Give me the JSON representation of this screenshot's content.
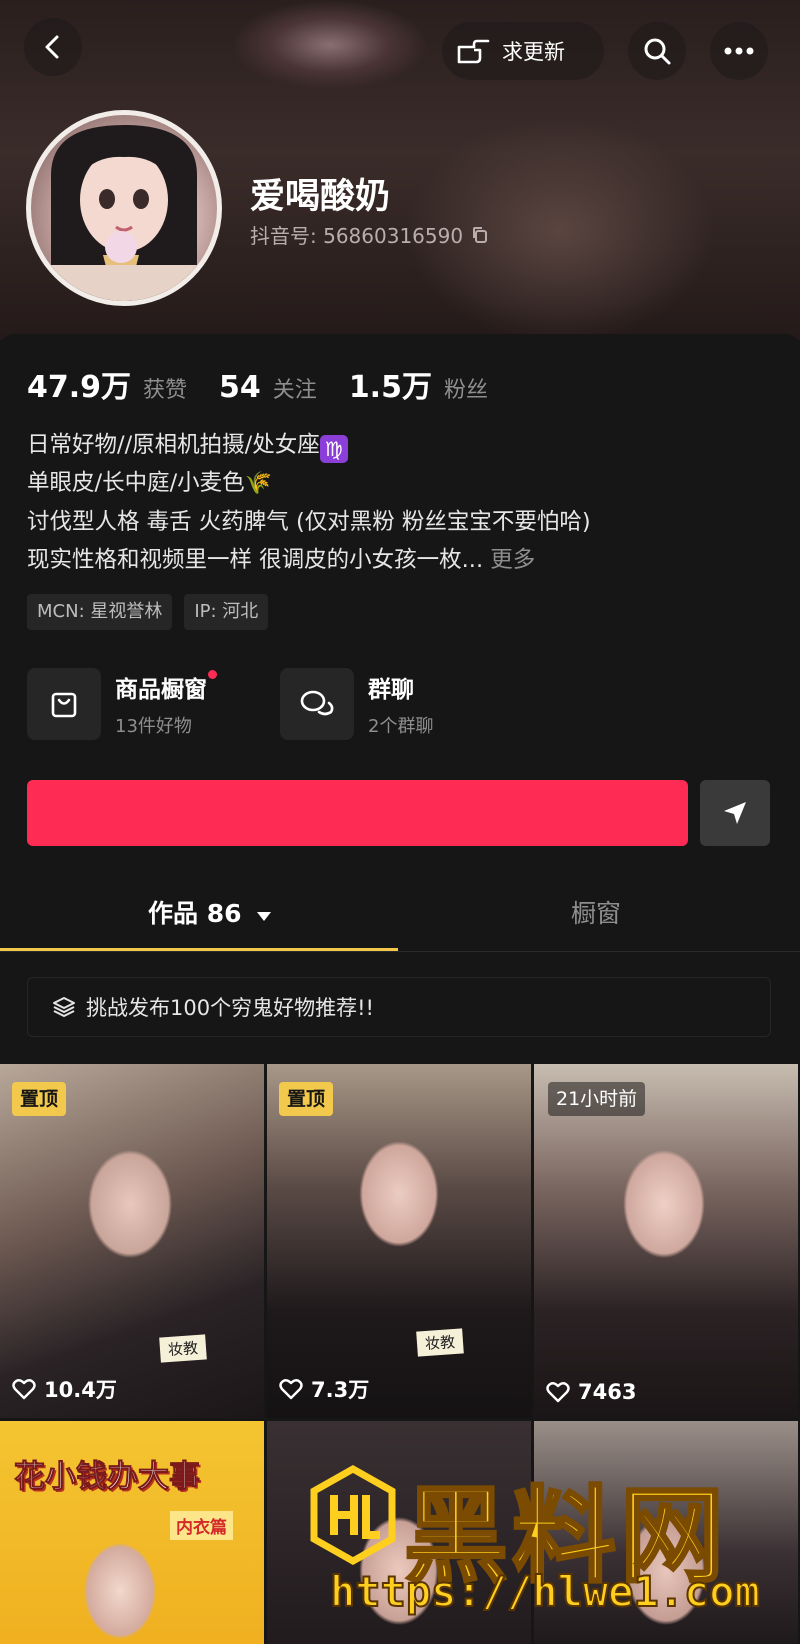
{
  "header": {
    "update_label": "求更新",
    "nickname": "爱喝酸奶",
    "douyin_id": "抖音号: 56860316590"
  },
  "stats": [
    {
      "value": "47.9万",
      "label": "获赞"
    },
    {
      "value": "54",
      "label": "关注"
    },
    {
      "value": "1.5万",
      "label": "粉丝"
    }
  ],
  "bio": {
    "line1": "日常好物//原相机拍摄/处女座",
    "line1_emoji": "♍",
    "line2": "单眼皮/长中庭/小麦色",
    "line2_emoji": "🌾",
    "line3": "讨伐型人格 毒舌 火药脾气 (仅对黑粉 粉丝宝宝不要怕哈)",
    "line4": "现实性格和视频里一样 很调皮的小女孩一枚...",
    "more": "更多"
  },
  "tags": [
    "MCN: 星视誉林",
    "IP: 河北"
  ],
  "features": [
    {
      "title": "商品橱窗",
      "sub": "13件好物",
      "icon": "shopping-bag-icon",
      "has_dot": true
    },
    {
      "title": "群聊",
      "sub": "2个群聊",
      "icon": "chat-bubbles-icon",
      "has_dot": false
    }
  ],
  "follow_label": "",
  "tabs": [
    {
      "label": "作品 86",
      "active": true
    },
    {
      "label": "橱窗",
      "active": false
    }
  ],
  "challenge": {
    "text": "挑战发布100个穷鬼好物推荐!!",
    "icon": "layers-icon"
  },
  "videos": [
    {
      "badge": "置顶",
      "badge_type": "pinned",
      "likes": "10.4万",
      "sticker": "妆教"
    },
    {
      "badge": "置顶",
      "badge_type": "pinned",
      "likes": "7.3万",
      "sticker": "妆教"
    },
    {
      "badge": "21小时前",
      "badge_type": "time",
      "likes": "7463",
      "sticker": ""
    },
    {
      "badge": "",
      "badge_type": "",
      "likes": "",
      "promo_title": "花小钱办大事",
      "promo_sub": "内衣篇"
    },
    {
      "badge": "",
      "badge_type": "",
      "likes": ""
    },
    {
      "badge": "",
      "badge_type": "",
      "likes": ""
    }
  ],
  "watermark": {
    "text": "黑料网",
    "url": "https://hlwe1.com"
  },
  "colors": {
    "accent_red": "#fe2c55",
    "tab_underline": "#f2c94c",
    "panel_bg": "#161616"
  }
}
